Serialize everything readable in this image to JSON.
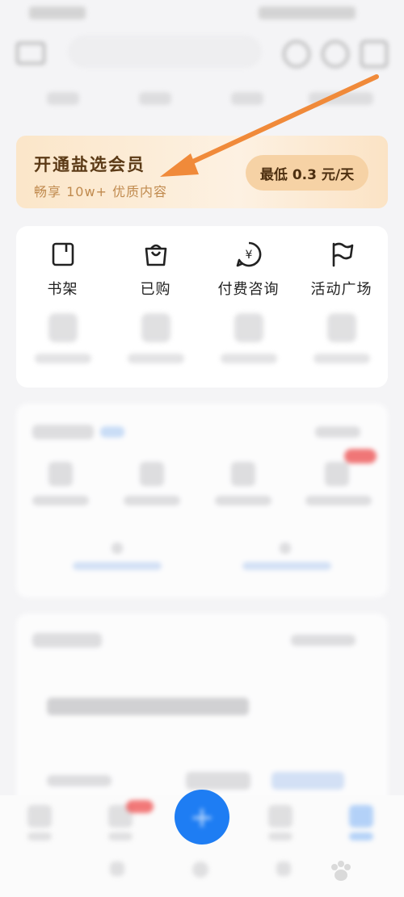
{
  "member_banner": {
    "title": "开通盐选会员",
    "subtitle": "畅享 10w+ 优质内容",
    "cta": "最低 0.3 元/天"
  },
  "services": [
    {
      "label": "书架",
      "icon": "bookshelf-icon"
    },
    {
      "label": "已购",
      "icon": "shopping-bag-icon"
    },
    {
      "label": "付费咨询",
      "icon": "paid-consult-icon"
    },
    {
      "label": "活动广场",
      "icon": "flag-icon"
    }
  ],
  "colors": {
    "member_title": "#5b3a16",
    "member_sub": "#c08a4e",
    "cta_bg": "#f6d2a5",
    "arrow": "#f08a3a",
    "fab": "#1e7df3"
  }
}
